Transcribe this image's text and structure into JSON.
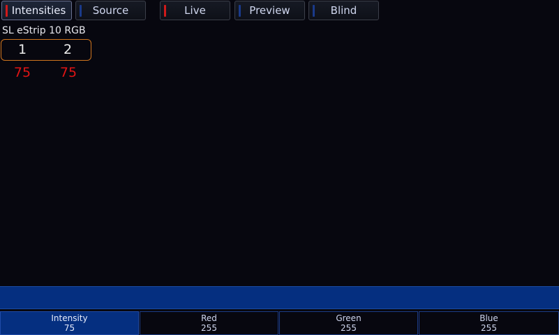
{
  "tabs": [
    {
      "label": "Intensities",
      "indicator_color": "#d01a1a",
      "active": true
    },
    {
      "label": "Source",
      "indicator_color": "#1a3a8a",
      "active": false
    },
    {
      "label": "Live",
      "indicator_color": "#d01a1a",
      "active": false
    },
    {
      "label": "Preview",
      "indicator_color": "#1a3a8a",
      "active": false
    },
    {
      "label": "Blind",
      "indicator_color": "#1a3a8a",
      "active": false
    }
  ],
  "fixture": {
    "label": "SL eStrip 10 RGB",
    "channels": [
      {
        "number": "1",
        "level": "75"
      },
      {
        "number": "2",
        "level": "75"
      }
    ]
  },
  "command_line": {
    "text": ""
  },
  "parameters": [
    {
      "name": "Intensity",
      "value": "75",
      "active": true
    },
    {
      "name": "Red",
      "value": "255",
      "active": false
    },
    {
      "name": "Green",
      "value": "255",
      "active": false
    },
    {
      "name": "Blue",
      "value": "255",
      "active": false
    }
  ],
  "colors": {
    "background": "#07070f",
    "accent_blue": "#052f80",
    "selection_orange": "#d0751e",
    "level_red": "#e01414"
  }
}
